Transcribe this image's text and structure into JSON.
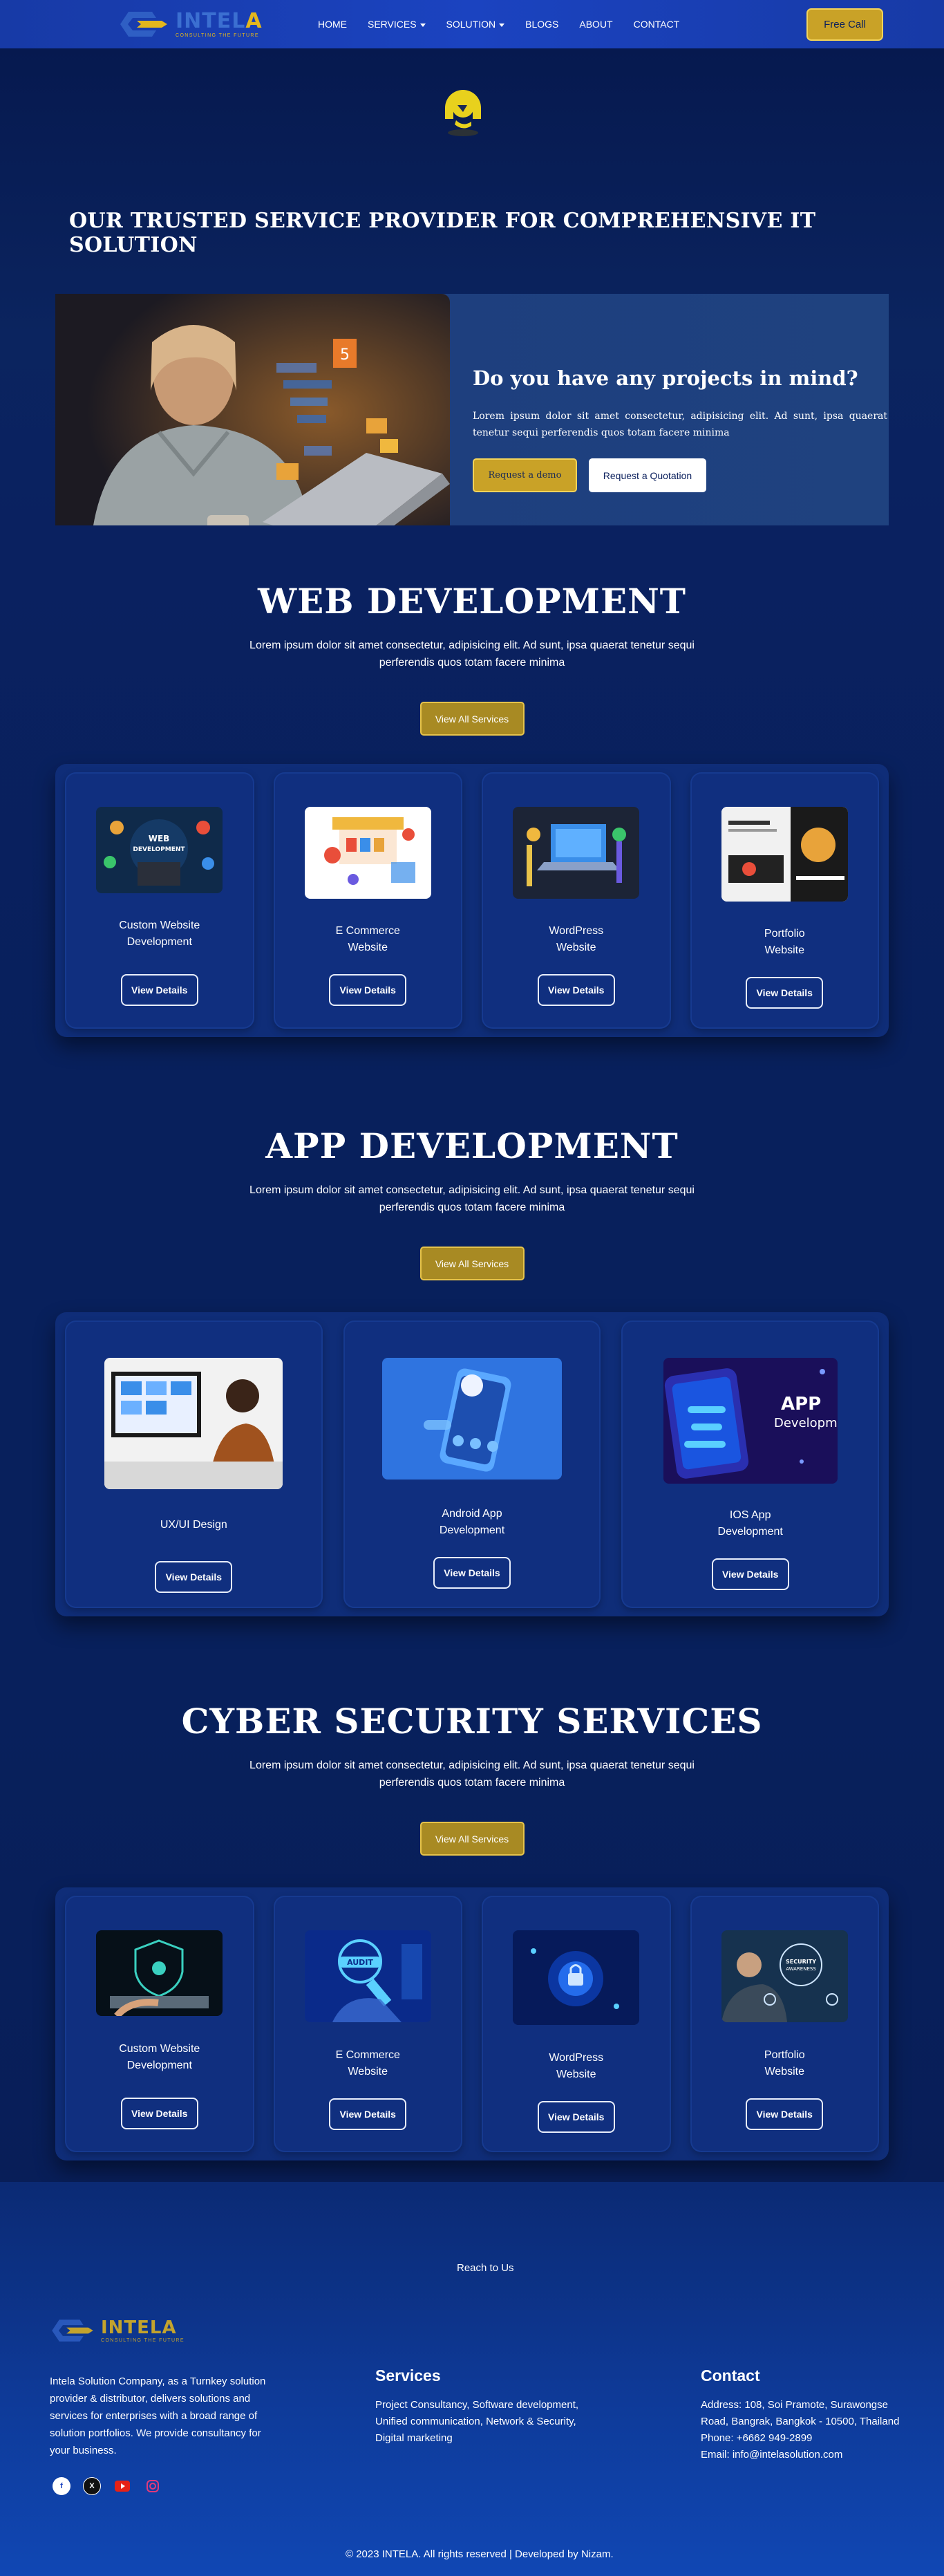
{
  "nav": {
    "logo_word_main": "INTEL",
    "logo_word_accent": "A",
    "logo_tagline": "CONSULTING THE FUTURE",
    "links": [
      {
        "label": "HOME"
      },
      {
        "label": "SERVICES"
      },
      {
        "label": "SOLUTION"
      },
      {
        "label": "BLOGS"
      },
      {
        "label": "ABOUT"
      },
      {
        "label": "CONTACT"
      }
    ],
    "cta": "Free Call"
  },
  "hero": {
    "title": "OUR TRUSTED SERVICE PROVIDER FOR COMPREHENSIVE IT SOLUTION",
    "promo_title": "Do you have any projects in mind?",
    "promo_text": "Lorem ipsum dolor sit amet consectetur, adipisicing elit. Ad sunt, ipsa quaerat tenetur sequi perferendis quos totam facere minima",
    "btn_demo": "Request a demo",
    "btn_quote": "Request a Quotation"
  },
  "web": {
    "title": "WEB DEVELOPMENT",
    "desc": "Lorem ipsum dolor sit amet consectetur, adipisicing elit. Ad sunt, ipsa quaerat tenetur sequi perferendis quos totam facere minima",
    "btn_all": "View All Services",
    "cards": [
      {
        "label": "Custom Website Development",
        "btn": "View Details"
      },
      {
        "label": "E Commerce Website",
        "btn": "View Details"
      },
      {
        "label": "WordPress Website",
        "btn": "View Details"
      },
      {
        "label": "Portfolio Website",
        "btn": "View Details"
      }
    ]
  },
  "app": {
    "title": "APP DEVELOPMENT",
    "desc": "Lorem ipsum dolor sit amet consectetur, adipisicing elit. Ad sunt, ipsa quaerat tenetur sequi perferendis quos totam facere minima",
    "btn_all": "View All Services",
    "cards": [
      {
        "label": "UX/UI Design",
        "btn": "View Details"
      },
      {
        "label": "Android App Development",
        "btn": "View Details"
      },
      {
        "label": "IOS App Development",
        "btn": "View Details"
      }
    ]
  },
  "cyber": {
    "title": "CYBER SECURITY SERVICES",
    "desc": "Lorem ipsum dolor sit amet consectetur, adipisicing elit. Ad sunt, ipsa quaerat tenetur sequi perferendis quos totam facere minima",
    "btn_all": "View All Services",
    "cards": [
      {
        "label": "Custom Website Development",
        "btn": "View Details"
      },
      {
        "label": "E Commerce Website",
        "btn": "View Details"
      },
      {
        "label": "WordPress Website",
        "btn": "View Details"
      },
      {
        "label": "Portfolio Website",
        "btn": "View Details"
      }
    ]
  },
  "footer": {
    "reach": "Reach to Us",
    "about": "Intela Solution Company, as a Turnkey solution provider & distributor, delivers solutions and services for enterprises with a broad range of solution portfolios. We provide consultancy for your business.",
    "services_title": "Services",
    "services_text": "Project Consultancy, Software development, Unified communication, Network & Security, Digital marketing",
    "contact_title": "Contact",
    "contact_address": "Address: 108, Soi Pramote, Surawongse Road, Bangrak, Bangkok - 10500, Thailand",
    "contact_phone": "Phone: +6662 949-2899",
    "contact_email": "Email: info@intelasolution.com",
    "copyright": "© 2023 INTELA. All rights reserved | Developed by Nizam."
  },
  "colors": {
    "accent_gold": "#c9a227",
    "brand_blue": "#1b43c0",
    "page_bg": "#0a1f5c"
  }
}
